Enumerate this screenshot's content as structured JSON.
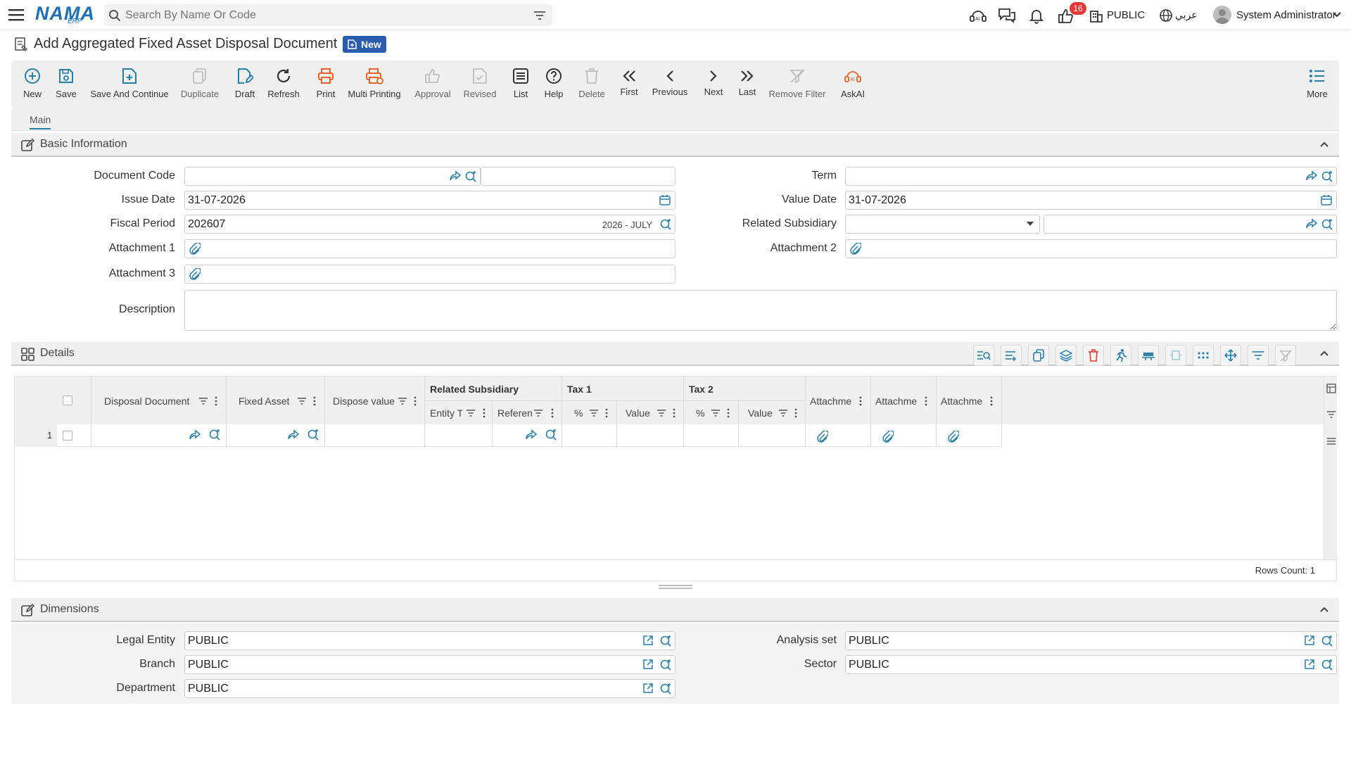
{
  "header": {
    "logo_text": "NAMA",
    "logo_sub": "ERP",
    "search_placeholder": "Search By Name Or Code",
    "notification_count": "16",
    "entity": "PUBLIC",
    "language": "عربي",
    "user": "System Administrator"
  },
  "page": {
    "title": "Add Aggregated Fixed Asset Disposal Document",
    "badge": "New"
  },
  "toolbar": {
    "new": "New",
    "save": "Save",
    "save_continue": "Save And Continue",
    "duplicate": "Duplicate",
    "draft": "Draft",
    "refresh": "Refresh",
    "print": "Print",
    "multi_printing": "Multi Printing",
    "approval": "Approval",
    "revised": "Revised",
    "list": "List",
    "help": "Help",
    "delete": "Delete",
    "first": "First",
    "previous": "Previous",
    "next": "Next",
    "last": "Last",
    "remove_filter": "Remove Filter",
    "askai": "AskAI",
    "more": "More"
  },
  "tabs": {
    "main": "Main"
  },
  "basic": {
    "title": "Basic Information",
    "document_code_label": "Document Code",
    "issue_date_label": "Issue Date",
    "issue_date": "31-07-2026",
    "fiscal_period_label": "Fiscal Period",
    "fiscal_period": "202607",
    "fiscal_period_name": "2026 - JULY",
    "attachment1_label": "Attachment 1",
    "attachment2_label": "Attachment 2",
    "attachment3_label": "Attachment 3",
    "description_label": "Description",
    "term_label": "Term",
    "value_date_label": "Value Date",
    "value_date": "31-07-2026",
    "related_subsidiary_label": "Related Subsidiary"
  },
  "details": {
    "title": "Details",
    "columns": {
      "disposal_document": "Disposal Document",
      "fixed_asset": "Fixed Asset",
      "dispose_value": "Dispose value",
      "related_subsidiary": "Related Subsidiary",
      "entity_type": "Entity Ty",
      "reference": "Referen",
      "tax1": "Tax 1",
      "tax2": "Tax 2",
      "percent": "%",
      "value": "Value",
      "attachment": "Attachme"
    },
    "row_number": "1",
    "rows_count_label": "Rows Count: 1"
  },
  "dimensions": {
    "title": "Dimensions",
    "legal_entity_label": "Legal Entity",
    "legal_entity": "PUBLIC",
    "branch_label": "Branch",
    "branch": "PUBLIC",
    "department_label": "Department",
    "department": "PUBLIC",
    "analysis_set_label": "Analysis set",
    "analysis_set": "PUBLIC",
    "sector_label": "Sector",
    "sector": "PUBLIC"
  },
  "colors": {
    "accent": "#2a7fa8",
    "logo": "#1f6fb5",
    "badge": "#2a5db0",
    "orange": "#e8632a",
    "notify": "#e53935"
  }
}
